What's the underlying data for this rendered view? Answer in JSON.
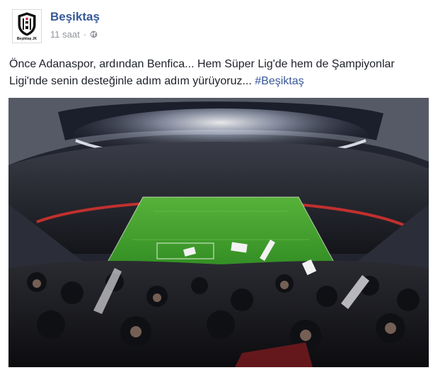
{
  "post": {
    "page_name": "Beşiktaş",
    "time": "11 saat",
    "separator": "·",
    "privacy_icon": "globe-icon",
    "text": "Önce Adanaspor, ardından Benfica... Hem Süper Lig'de hem de Şampiyonlar Ligi'nde senin desteğinle adım adım yürüyoruz...",
    "hashtag": "#Beşiktaş",
    "avatar_caption": "Beşiktaş JK"
  },
  "colors": {
    "link": "#365899",
    "meta": "#90949c",
    "text": "#1d2129",
    "pitch": "#3f9a2e"
  }
}
